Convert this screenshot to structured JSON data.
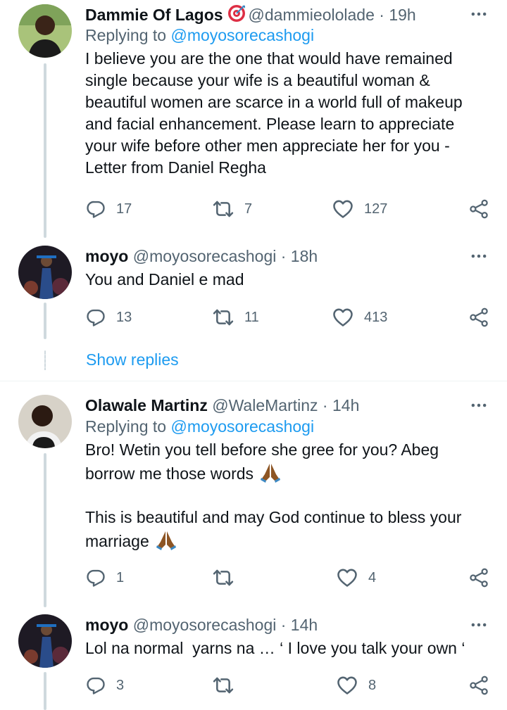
{
  "tweets": [
    {
      "name": "Dammie Of Lagos",
      "handle": "@dammieololade",
      "time": "19h",
      "replying_prefix": "Replying to",
      "replying_to": "@moyosorecashogi",
      "text": "I believe you are the one that would have remained\nsingle because your wife is a beautiful woman &\nbeautiful women are scarce in a world full of makeup\nand facial enhancement. Please learn to appreciate\nyour wife before other men appreciate her for you -\nLetter from Daniel Regha",
      "replies": "17",
      "retweets": "7",
      "likes": "127"
    },
    {
      "name": "moyo",
      "handle": "@moyosorecashogi",
      "time": "18h",
      "text": "You and Daniel e mad",
      "replies": "13",
      "retweets": "11",
      "likes": "413"
    },
    {
      "name": "Olawale Martinz",
      "handle": "@WaleMartinz",
      "time": "14h",
      "replying_prefix": "Replying to",
      "replying_to": "@moyosorecashogi",
      "text_line1": "Bro! Wetin you tell before she gree for you? Abeg",
      "text_line2": "borrow me those words",
      "text_line3": "This is beautiful and may God continue to bless your",
      "text_line4": "marriage",
      "replies": "1",
      "retweets": "",
      "likes": "4"
    },
    {
      "name": "moyo",
      "handle": "@moyosorecashogi",
      "time": "14h",
      "text": "Lol na normal  yarns na … ‘ I love you talk your own ‘",
      "replies": "3",
      "retweets": "",
      "likes": "8"
    }
  ],
  "show_replies": "Show replies",
  "dot": "·",
  "colors": {
    "accent": "#1d9bf0",
    "muted": "#536471",
    "text": "#0f1419",
    "line": "#cfd9de"
  },
  "icons": [
    "reply-icon",
    "retweet-icon",
    "like-icon",
    "share-icon",
    "more-icon",
    "target-emoji-icon",
    "folded-hands-emoji-icon"
  ]
}
